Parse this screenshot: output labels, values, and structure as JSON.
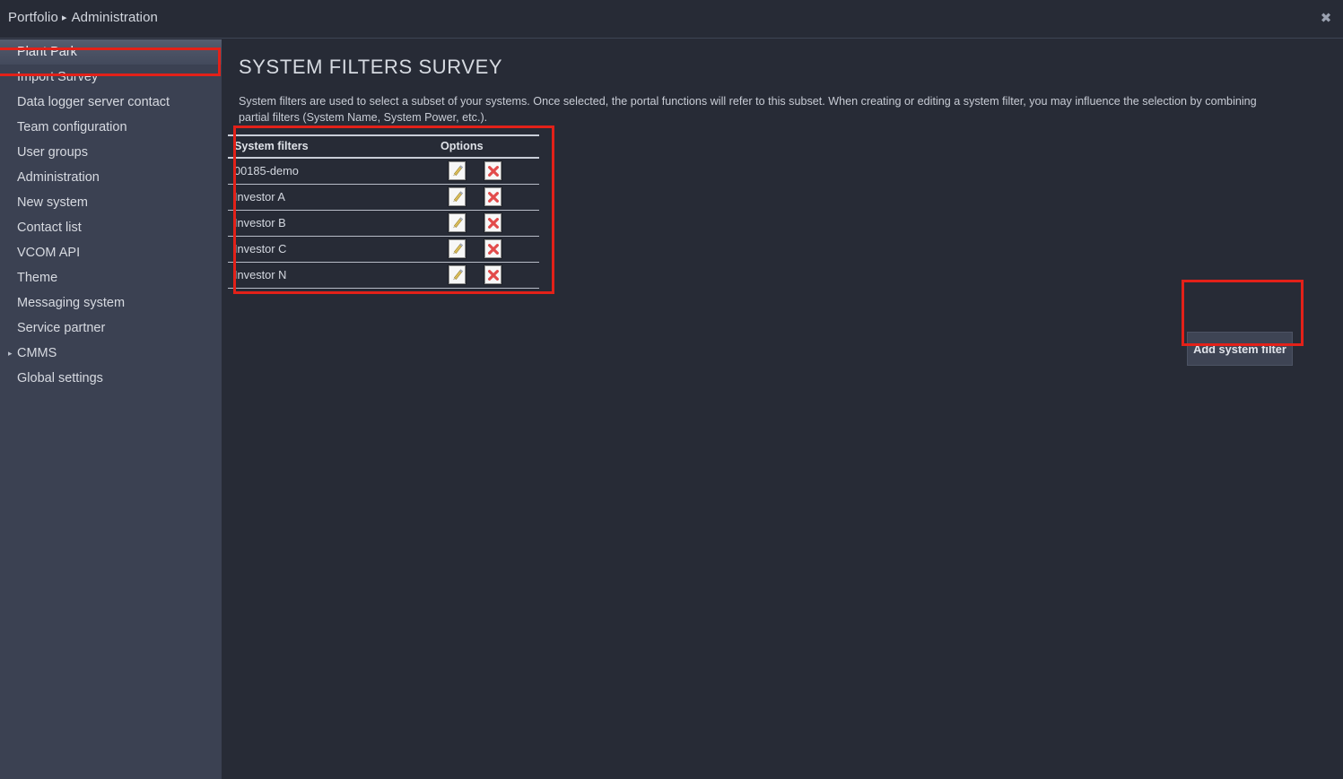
{
  "window": {
    "close_icon": "close-icon"
  },
  "breadcrumb": {
    "root": "Portfolio",
    "separator": "▸",
    "current": "Administration"
  },
  "sidebar": {
    "items": [
      {
        "label": "Plant Park",
        "selected": true,
        "expandable": false
      },
      {
        "label": "Import Survey",
        "selected": false,
        "expandable": false
      },
      {
        "label": "Data logger server contact",
        "selected": false,
        "expandable": false
      },
      {
        "label": "Team configuration",
        "selected": false,
        "expandable": false
      },
      {
        "label": "User groups",
        "selected": false,
        "expandable": false
      },
      {
        "label": "Administration",
        "selected": false,
        "expandable": false
      },
      {
        "label": "New system",
        "selected": false,
        "expandable": false
      },
      {
        "label": "Contact list",
        "selected": false,
        "expandable": false
      },
      {
        "label": "VCOM API",
        "selected": false,
        "expandable": false
      },
      {
        "label": "Theme",
        "selected": false,
        "expandable": false
      },
      {
        "label": "Messaging system",
        "selected": false,
        "expandable": false
      },
      {
        "label": "Service partner",
        "selected": false,
        "expandable": false
      },
      {
        "label": "CMMS",
        "selected": false,
        "expandable": true
      },
      {
        "label": "Global settings",
        "selected": false,
        "expandable": false
      }
    ]
  },
  "main": {
    "title": "SYSTEM FILTERS SURVEY",
    "description": "System filters are used to select a subset of your systems. Once selected, the portal functions will refer to this subset. When creating or editing a system filter, you may influence the selection by combining partial filters (System Name, System Power, etc.).",
    "table": {
      "columns": [
        "System filters",
        "Options"
      ],
      "rows": [
        {
          "name": "00185-demo",
          "edit_icon": "pencil-edit-icon",
          "delete_icon": "red-x-delete-icon"
        },
        {
          "name": "Investor A",
          "edit_icon": "pencil-edit-icon",
          "delete_icon": "red-x-delete-icon"
        },
        {
          "name": "Investor B",
          "edit_icon": "pencil-edit-icon",
          "delete_icon": "red-x-delete-icon"
        },
        {
          "name": "Investor C",
          "edit_icon": "pencil-edit-icon",
          "delete_icon": "red-x-delete-icon"
        },
        {
          "name": "Investor N",
          "edit_icon": "pencil-edit-icon",
          "delete_icon": "red-x-delete-icon"
        }
      ]
    },
    "add_button_label": "Add system filter"
  },
  "colors": {
    "app_background": "#272b36",
    "sidebar_background": "#3b4152",
    "annotation_red": "#e32119",
    "text_primary": "#d6dae1",
    "button_background": "#3e4454",
    "delete_icon_red": "#e24b4b",
    "edit_icon_yellow": "#f2d26a"
  }
}
